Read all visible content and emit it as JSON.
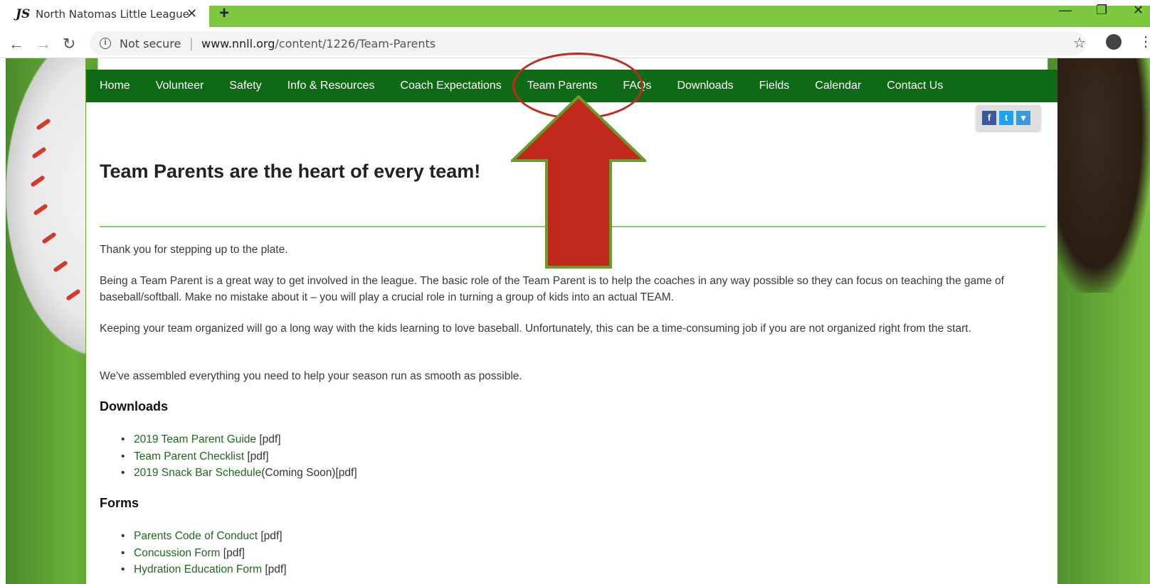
{
  "browser": {
    "tab_title": "North Natomas Little League",
    "tab_close": "✕",
    "new_tab": "+",
    "not_secure": "Not secure",
    "url_domain": "www.nnll.org",
    "url_path": "/content/1226/Team-Parents"
  },
  "nav": {
    "items": [
      "Home",
      "Volunteer",
      "Safety",
      "Info & Resources",
      "Coach Expectations",
      "Team Parents",
      "FAQs",
      "Downloads",
      "Fields",
      "Calendar",
      "Contact Us"
    ]
  },
  "share": {
    "facebook": "f",
    "twitter": "t",
    "more": "▾"
  },
  "content": {
    "title": "Team Parents are the heart of every team!",
    "p1": "Thank you for stepping up to the plate.",
    "p2": "Being a Team Parent is a great way to get involved in the league. The basic role of the Team Parent is to help the coaches in any way possible so they can focus on teaching the game of baseball/softball. Make no mistake about it – you will play a crucial role in turning a group of kids into an actual TEAM.",
    "p3": "Keeping your team organized will go a long way with the kids learning to love baseball. Unfortunately, this can be a time-consuming job if you are not organized right from the start.",
    "p4": "We've assembled everything you need to help your season run as smooth as possible.",
    "downloads_heading": "Downloads",
    "downloads": [
      {
        "link": "2019 Team Parent Guide",
        "suffix": " [pdf]"
      },
      {
        "link": "Team Parent Checklist",
        "suffix": " [pdf]"
      },
      {
        "link": "2019 Snack Bar Schedule",
        "suffix": "(Coming Soon)[pdf]"
      }
    ],
    "forms_heading": "Forms",
    "forms": [
      {
        "link": "Parents Code of Conduct",
        "suffix": " [pdf]"
      },
      {
        "link": "Concussion Form",
        "suffix": " [pdf]"
      },
      {
        "link": "Hydration Education Form",
        "suffix": " [pdf]"
      }
    ]
  },
  "colors": {
    "nav_bg": "#0f6a16",
    "tab_accent": "#7ec83f",
    "link": "#1e6b1e",
    "annotation": "#c0291c"
  }
}
